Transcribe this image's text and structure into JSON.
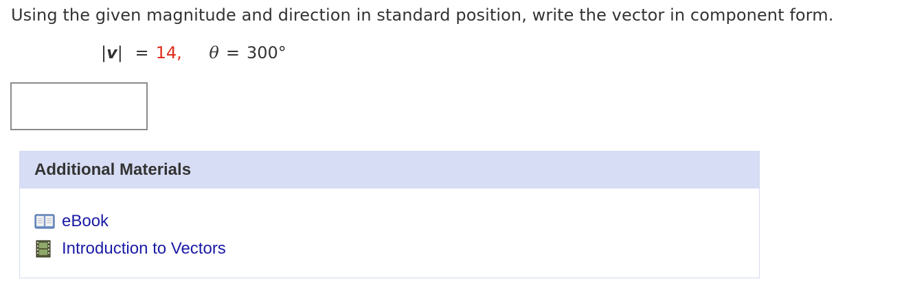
{
  "question": {
    "prompt": "Using the given magnitude and direction in standard position, write the vector in component form.",
    "magnitude_lhs_open": "|",
    "magnitude_var": "v",
    "magnitude_lhs_close": "|",
    "equals": "=",
    "magnitude_value": "14,",
    "theta_symbol": "θ",
    "theta_equals": "=",
    "theta_value": "300°",
    "magnitude_color": "#e02b1b"
  },
  "answer": {
    "value": "",
    "placeholder": ""
  },
  "additional_materials": {
    "title": "Additional Materials",
    "header_color": "#d7ddf4",
    "items": [
      {
        "label": "eBook",
        "icon": "book-icon"
      },
      {
        "label": "Introduction to Vectors",
        "icon": "film-icon"
      }
    ],
    "link_color": "#1a1aa6"
  }
}
